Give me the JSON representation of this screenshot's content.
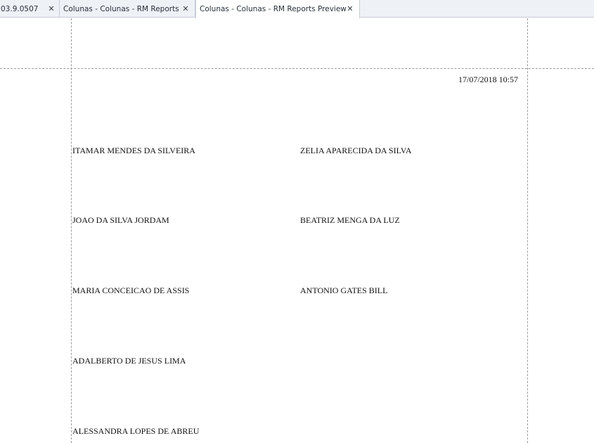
{
  "tabs": [
    {
      "label": "03.9.0507",
      "close": "✕"
    },
    {
      "label": "Colunas - Colunas - RM Reports",
      "close": "✕"
    },
    {
      "label": "Colunas - Colunas - RM Reports Preview",
      "close": "✕",
      "active": true
    }
  ],
  "report": {
    "timestamp": "17/07/2018 10:57",
    "names_left": [
      "ITAMAR MENDES DA SILVEIRA",
      "JOAO DA SILVA JORDAM",
      "MARIA CONCEICAO DE ASSIS",
      "ADALBERTO DE JESUS LIMA",
      "ALESSANDRA LOPES DE ABREU"
    ],
    "names_right": [
      "ZELIA APARECIDA DA SILVA",
      "BEATRIZ MENGA DA LUZ",
      "ANTONIO GATES BILL"
    ]
  }
}
